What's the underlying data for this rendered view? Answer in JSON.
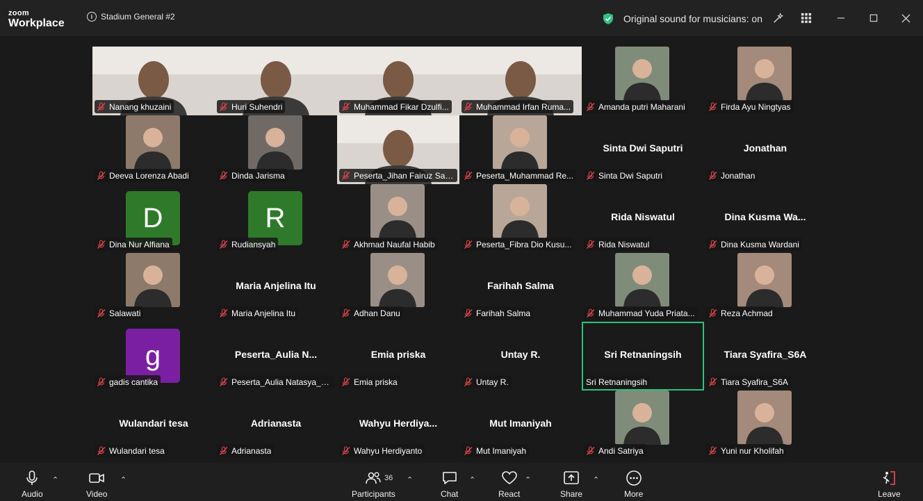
{
  "app": {
    "brand_small": "zoom",
    "brand_name": "Workplace",
    "meeting_title": "Stadium General #2",
    "sound_status": "Original sound for musicians: on"
  },
  "colors": {
    "active_speaker": "#2ec27e",
    "mic_muted": "#e0464b",
    "avatar_green": "#2f7a2a",
    "avatar_purple": "#7b1fa2"
  },
  "tiles": [
    {
      "label": "Nanang khuzaini",
      "big": "",
      "kind": "video"
    },
    {
      "label": "Huri Suhendri",
      "big": "",
      "kind": "video"
    },
    {
      "label": "Muhammad Fikar Dzulfi...",
      "big": "",
      "kind": "video"
    },
    {
      "label": "Muhammad Irfan Ruma...",
      "big": "",
      "kind": "video"
    },
    {
      "label": "Amanda putri Maharani",
      "big": "",
      "kind": "photo"
    },
    {
      "label": "Firda Ayu Ningtyas",
      "big": "",
      "kind": "photo"
    },
    {
      "label": "Deeva Lorenza Abadi",
      "big": "",
      "kind": "photo"
    },
    {
      "label": "Dinda Jarisma",
      "big": "",
      "kind": "photo"
    },
    {
      "label": "Peserta_Jihan Fairuz Sals...",
      "big": "",
      "kind": "video"
    },
    {
      "label": "Peserta_Muhammad Re...",
      "big": "",
      "kind": "photo"
    },
    {
      "label": "Sinta Dwi Saputri",
      "big": "Sinta Dwi Saputri",
      "kind": "name"
    },
    {
      "label": "Jonathan",
      "big": "Jonathan",
      "kind": "name"
    },
    {
      "label": "Dina Nur Alfiana",
      "big": "",
      "kind": "avatar",
      "letter": "D",
      "color": "#2f7a2a"
    },
    {
      "label": "Rudiansyah",
      "big": "",
      "kind": "avatar",
      "letter": "R",
      "color": "#2f7a2a"
    },
    {
      "label": "Akhmad Naufal Habib",
      "big": "",
      "kind": "photo"
    },
    {
      "label": "Peserta_Fibra Dio Kusu...",
      "big": "",
      "kind": "photo"
    },
    {
      "label": "Rida Niswatul",
      "big": "Rida Niswatul",
      "kind": "name"
    },
    {
      "label": "Dina Kusma Wardani",
      "big": "Dina  Kusma  Wa...",
      "kind": "name"
    },
    {
      "label": "Salawati",
      "big": "",
      "kind": "photo"
    },
    {
      "label": "Maria Anjelina Itu",
      "big": "Maria Anjelina Itu",
      "kind": "name"
    },
    {
      "label": "Adhan Danu",
      "big": "",
      "kind": "photo"
    },
    {
      "label": "Farihah Salma",
      "big": "Farihah Salma",
      "kind": "name"
    },
    {
      "label": "Muhammad Yuda Priata...",
      "big": "",
      "kind": "photo"
    },
    {
      "label": "Reza Achmad",
      "big": "",
      "kind": "photo"
    },
    {
      "label": "gadis cantika",
      "big": "",
      "kind": "avatar",
      "letter": "g",
      "color": "#7b1fa2"
    },
    {
      "label": "Peserta_Aulia Natasya_u...",
      "big": "Peserta_Aulia  N...",
      "kind": "name"
    },
    {
      "label": "Emia priska",
      "big": "Emia priska",
      "kind": "name"
    },
    {
      "label": "Untay R.",
      "big": "Untay R.",
      "kind": "name"
    },
    {
      "label": "Sri Retnaningsih",
      "big": "Sri Retnaningsih",
      "kind": "name",
      "active": true,
      "unmuted": true
    },
    {
      "label": "Tiara Syafira_S6A",
      "big": "Tiara Syafira_S6A",
      "kind": "name"
    },
    {
      "label": "Wulandari tesa",
      "big": "Wulandari tesa",
      "kind": "name"
    },
    {
      "label": "Adrianasta",
      "big": "Adrianasta",
      "kind": "name"
    },
    {
      "label": "Wahyu Herdiyanto",
      "big": "Wahyu  Herdiya...",
      "kind": "name"
    },
    {
      "label": "Mut Imaniyah",
      "big": "Mut Imaniyah",
      "kind": "name"
    },
    {
      "label": "Andi Satriya",
      "big": "",
      "kind": "photo"
    },
    {
      "label": "Yuni nur Kholifah",
      "big": "",
      "kind": "photo"
    }
  ],
  "toolbar": {
    "audio": "Audio",
    "video": "Video",
    "participants": "Participants",
    "participants_count": "36",
    "chat": "Chat",
    "react": "React",
    "share": "Share",
    "more": "More",
    "leave": "Leave"
  }
}
